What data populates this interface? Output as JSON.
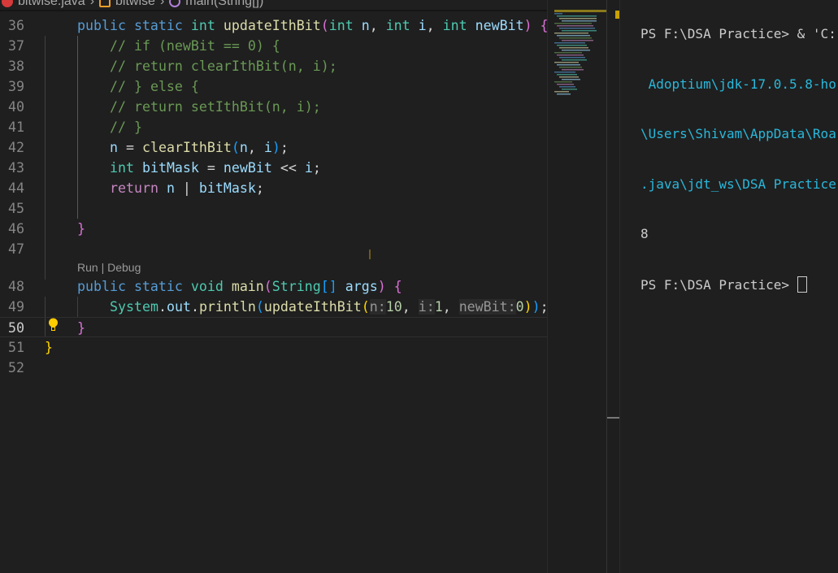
{
  "breadcrumb": {
    "file": "bitwise.java",
    "class": "bitwise",
    "method": "main(String[])"
  },
  "editor": {
    "codelens": {
      "run": "Run",
      "sep": " | ",
      "debug": "Debug"
    },
    "active_line": "50",
    "lines": [
      {
        "n": "36",
        "indent": 1,
        "t": [
          [
            "public ",
            "kw"
          ],
          [
            "static ",
            "kw"
          ],
          [
            "int ",
            "ty"
          ],
          [
            "updateIthBit",
            "fn"
          ],
          [
            "(",
            "p2"
          ],
          [
            "int ",
            "ty"
          ],
          [
            "n",
            "var"
          ],
          [
            ", ",
            "op"
          ],
          [
            "int ",
            "ty"
          ],
          [
            "i",
            "var"
          ],
          [
            ", ",
            "op"
          ],
          [
            "int ",
            "ty"
          ],
          [
            "newBit",
            "var"
          ],
          [
            ") ",
            "p2"
          ],
          [
            "{",
            "p2"
          ]
        ]
      },
      {
        "n": "37",
        "indent": 2,
        "t": [
          [
            "// if (newBit == 0) {",
            "cm"
          ]
        ]
      },
      {
        "n": "38",
        "indent": 2,
        "t": [
          [
            "// return clearIthBit(n, i);",
            "cm"
          ]
        ]
      },
      {
        "n": "39",
        "indent": 2,
        "t": [
          [
            "// } else {",
            "cm"
          ]
        ]
      },
      {
        "n": "40",
        "indent": 2,
        "t": [
          [
            "// return setIthBit(n, i);",
            "cm"
          ]
        ]
      },
      {
        "n": "41",
        "indent": 2,
        "t": [
          [
            "// }",
            "cm"
          ]
        ]
      },
      {
        "n": "42",
        "indent": 2,
        "t": [
          [
            "n",
            "var"
          ],
          [
            " = ",
            "op"
          ],
          [
            "clearIthBit",
            "fn"
          ],
          [
            "(",
            "p3"
          ],
          [
            "n",
            "var"
          ],
          [
            ", ",
            "op"
          ],
          [
            "i",
            "var"
          ],
          [
            ")",
            "p3"
          ],
          [
            ";",
            "op"
          ]
        ]
      },
      {
        "n": "43",
        "indent": 2,
        "t": [
          [
            "int ",
            "ty"
          ],
          [
            "bitMask",
            "var"
          ],
          [
            " = ",
            "op"
          ],
          [
            "newBit",
            "var"
          ],
          [
            " << ",
            "op"
          ],
          [
            "i",
            "var"
          ],
          [
            ";",
            "op"
          ]
        ]
      },
      {
        "n": "44",
        "indent": 2,
        "t": [
          [
            "return ",
            "ctl"
          ],
          [
            "n",
            "var"
          ],
          [
            " | ",
            "op"
          ],
          [
            "bitMask",
            "var"
          ],
          [
            ";",
            "op"
          ]
        ]
      },
      {
        "n": "45",
        "indent": 0,
        "t": []
      },
      {
        "n": "46",
        "indent": 1,
        "t": [
          [
            "}",
            "p2"
          ]
        ]
      },
      {
        "n": "47",
        "indent": 0,
        "t": []
      },
      {
        "n": "48",
        "indent": 1,
        "t": [
          [
            "public ",
            "kw"
          ],
          [
            "static ",
            "kw"
          ],
          [
            "void ",
            "ty"
          ],
          [
            "main",
            "fn"
          ],
          [
            "(",
            "p2"
          ],
          [
            "String",
            "ty"
          ],
          [
            "[]",
            "p3"
          ],
          [
            " args",
            "var"
          ],
          [
            ") ",
            "p2"
          ],
          [
            "{",
            "p2"
          ]
        ]
      },
      {
        "n": "49",
        "indent": 2,
        "t": [
          [
            "System",
            "ty"
          ],
          [
            ".",
            "op"
          ],
          [
            "out",
            "var"
          ],
          [
            ".",
            "op"
          ],
          [
            "println",
            "fn"
          ],
          [
            "(",
            "p3"
          ],
          [
            "updateIthBit",
            "fn"
          ],
          [
            "(",
            "p1"
          ],
          [
            "n:",
            "hint"
          ],
          [
            "10",
            "num"
          ],
          [
            ", ",
            "op"
          ],
          [
            "i:",
            "hint"
          ],
          [
            "1",
            "num"
          ],
          [
            ", ",
            "op"
          ],
          [
            "newBit:",
            "hint"
          ],
          [
            "0",
            "num"
          ],
          [
            ")",
            "p1"
          ],
          [
            ")",
            "p3"
          ],
          [
            ";",
            "op"
          ]
        ]
      },
      {
        "n": "50",
        "indent": 1,
        "t": [
          [
            "}",
            "p2"
          ]
        ]
      },
      {
        "n": "51",
        "indent": 0,
        "t": [
          [
            "}",
            "p1"
          ]
        ]
      },
      {
        "n": "52",
        "indent": 0,
        "t": []
      }
    ]
  },
  "terminal": {
    "lines": [
      "PS F:\\DSA Practice> & 'C:",
      " Adoptium\\jdk-17.0.5.8-ho",
      "\\Users\\Shivam\\AppData\\Roa",
      ".java\\jdt_ws\\DSA Practice",
      "8",
      "PS F:\\DSA Practice> "
    ]
  }
}
